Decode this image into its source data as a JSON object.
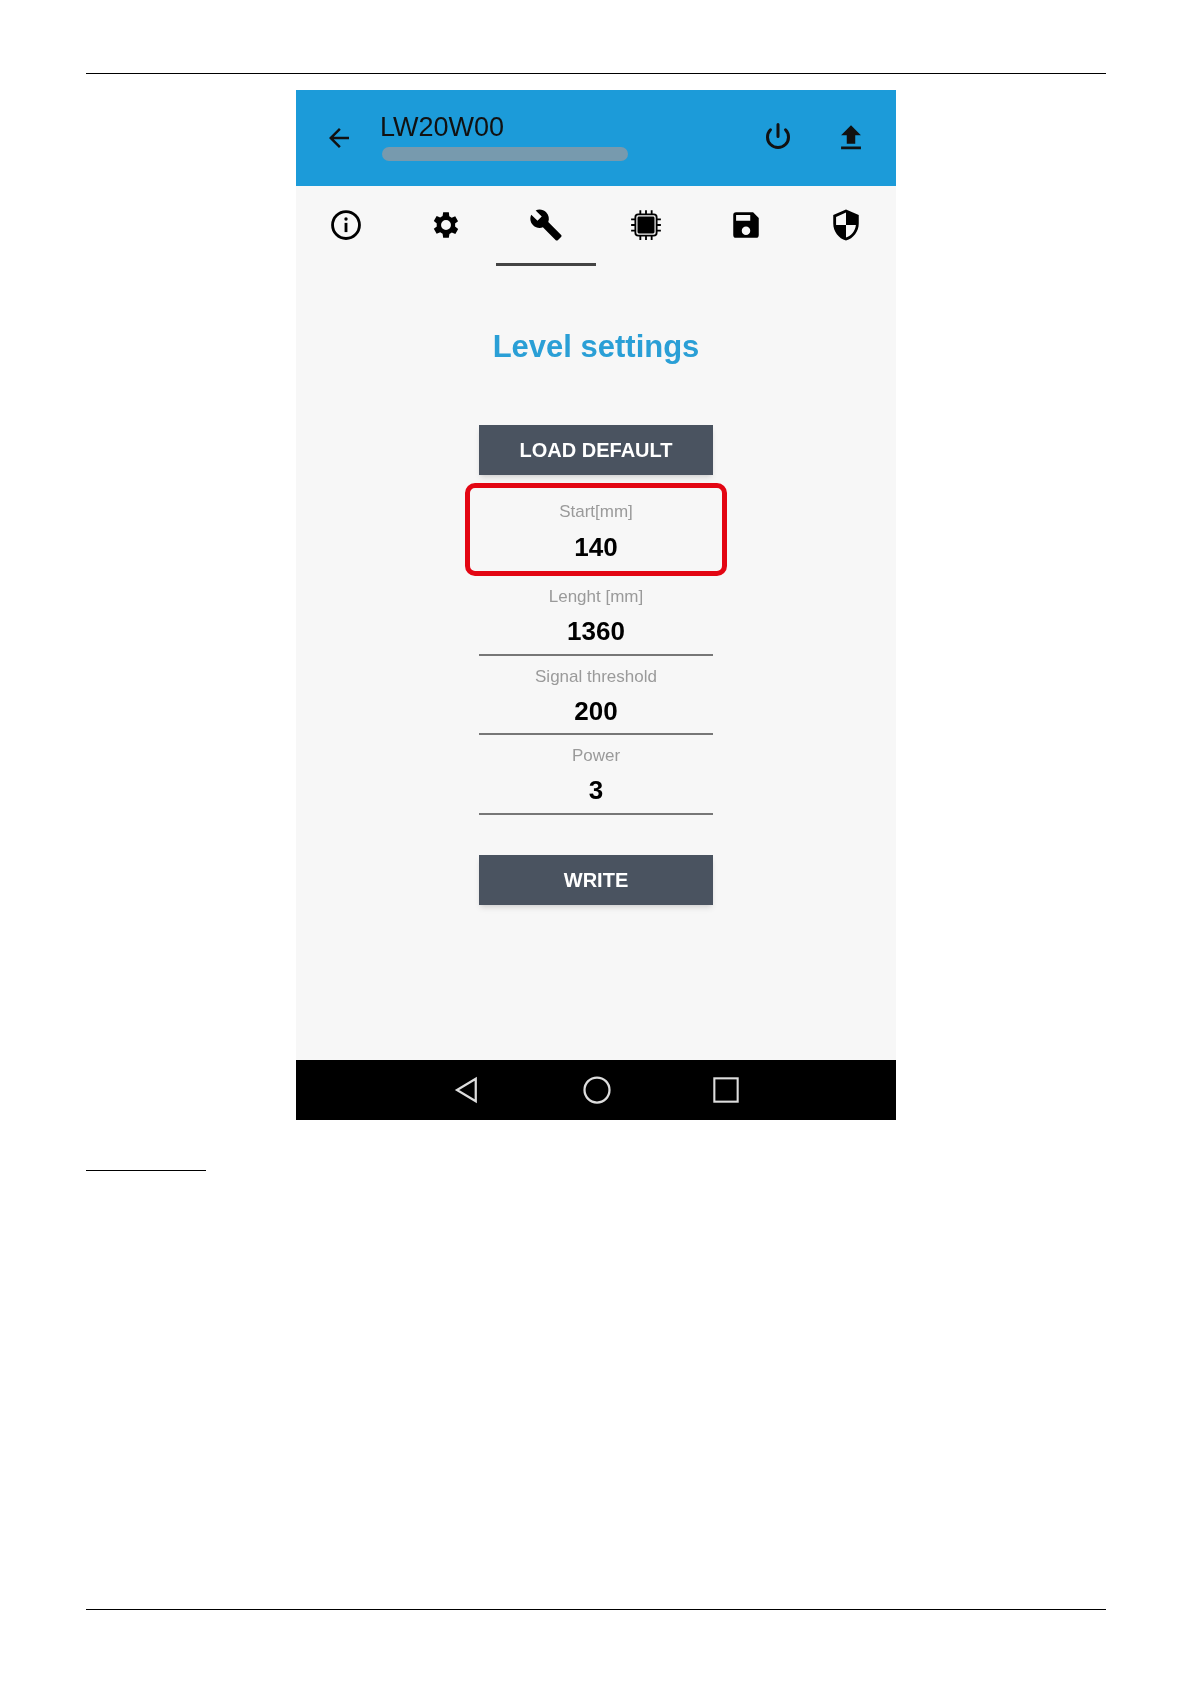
{
  "app_bar": {
    "title": "LW20W00"
  },
  "tabs": [
    {
      "kind": "info",
      "selected": false
    },
    {
      "kind": "gear",
      "selected": false
    },
    {
      "kind": "wrench",
      "selected": true
    },
    {
      "kind": "chip",
      "selected": false
    },
    {
      "kind": "floppy",
      "selected": false
    },
    {
      "kind": "shield",
      "selected": false
    }
  ],
  "heading": "Level settings",
  "load_button": "LOAD DEFAULT",
  "fields": [
    {
      "label": "Start[mm]",
      "value": "140",
      "highlighted": true
    },
    {
      "label": "Lenght [mm]",
      "value": "1360",
      "highlighted": false
    },
    {
      "label": "Signal threshold",
      "value": "200",
      "highlighted": false
    },
    {
      "label": "Power",
      "value": "3",
      "highlighted": false
    }
  ],
  "write_button": "WRITE"
}
